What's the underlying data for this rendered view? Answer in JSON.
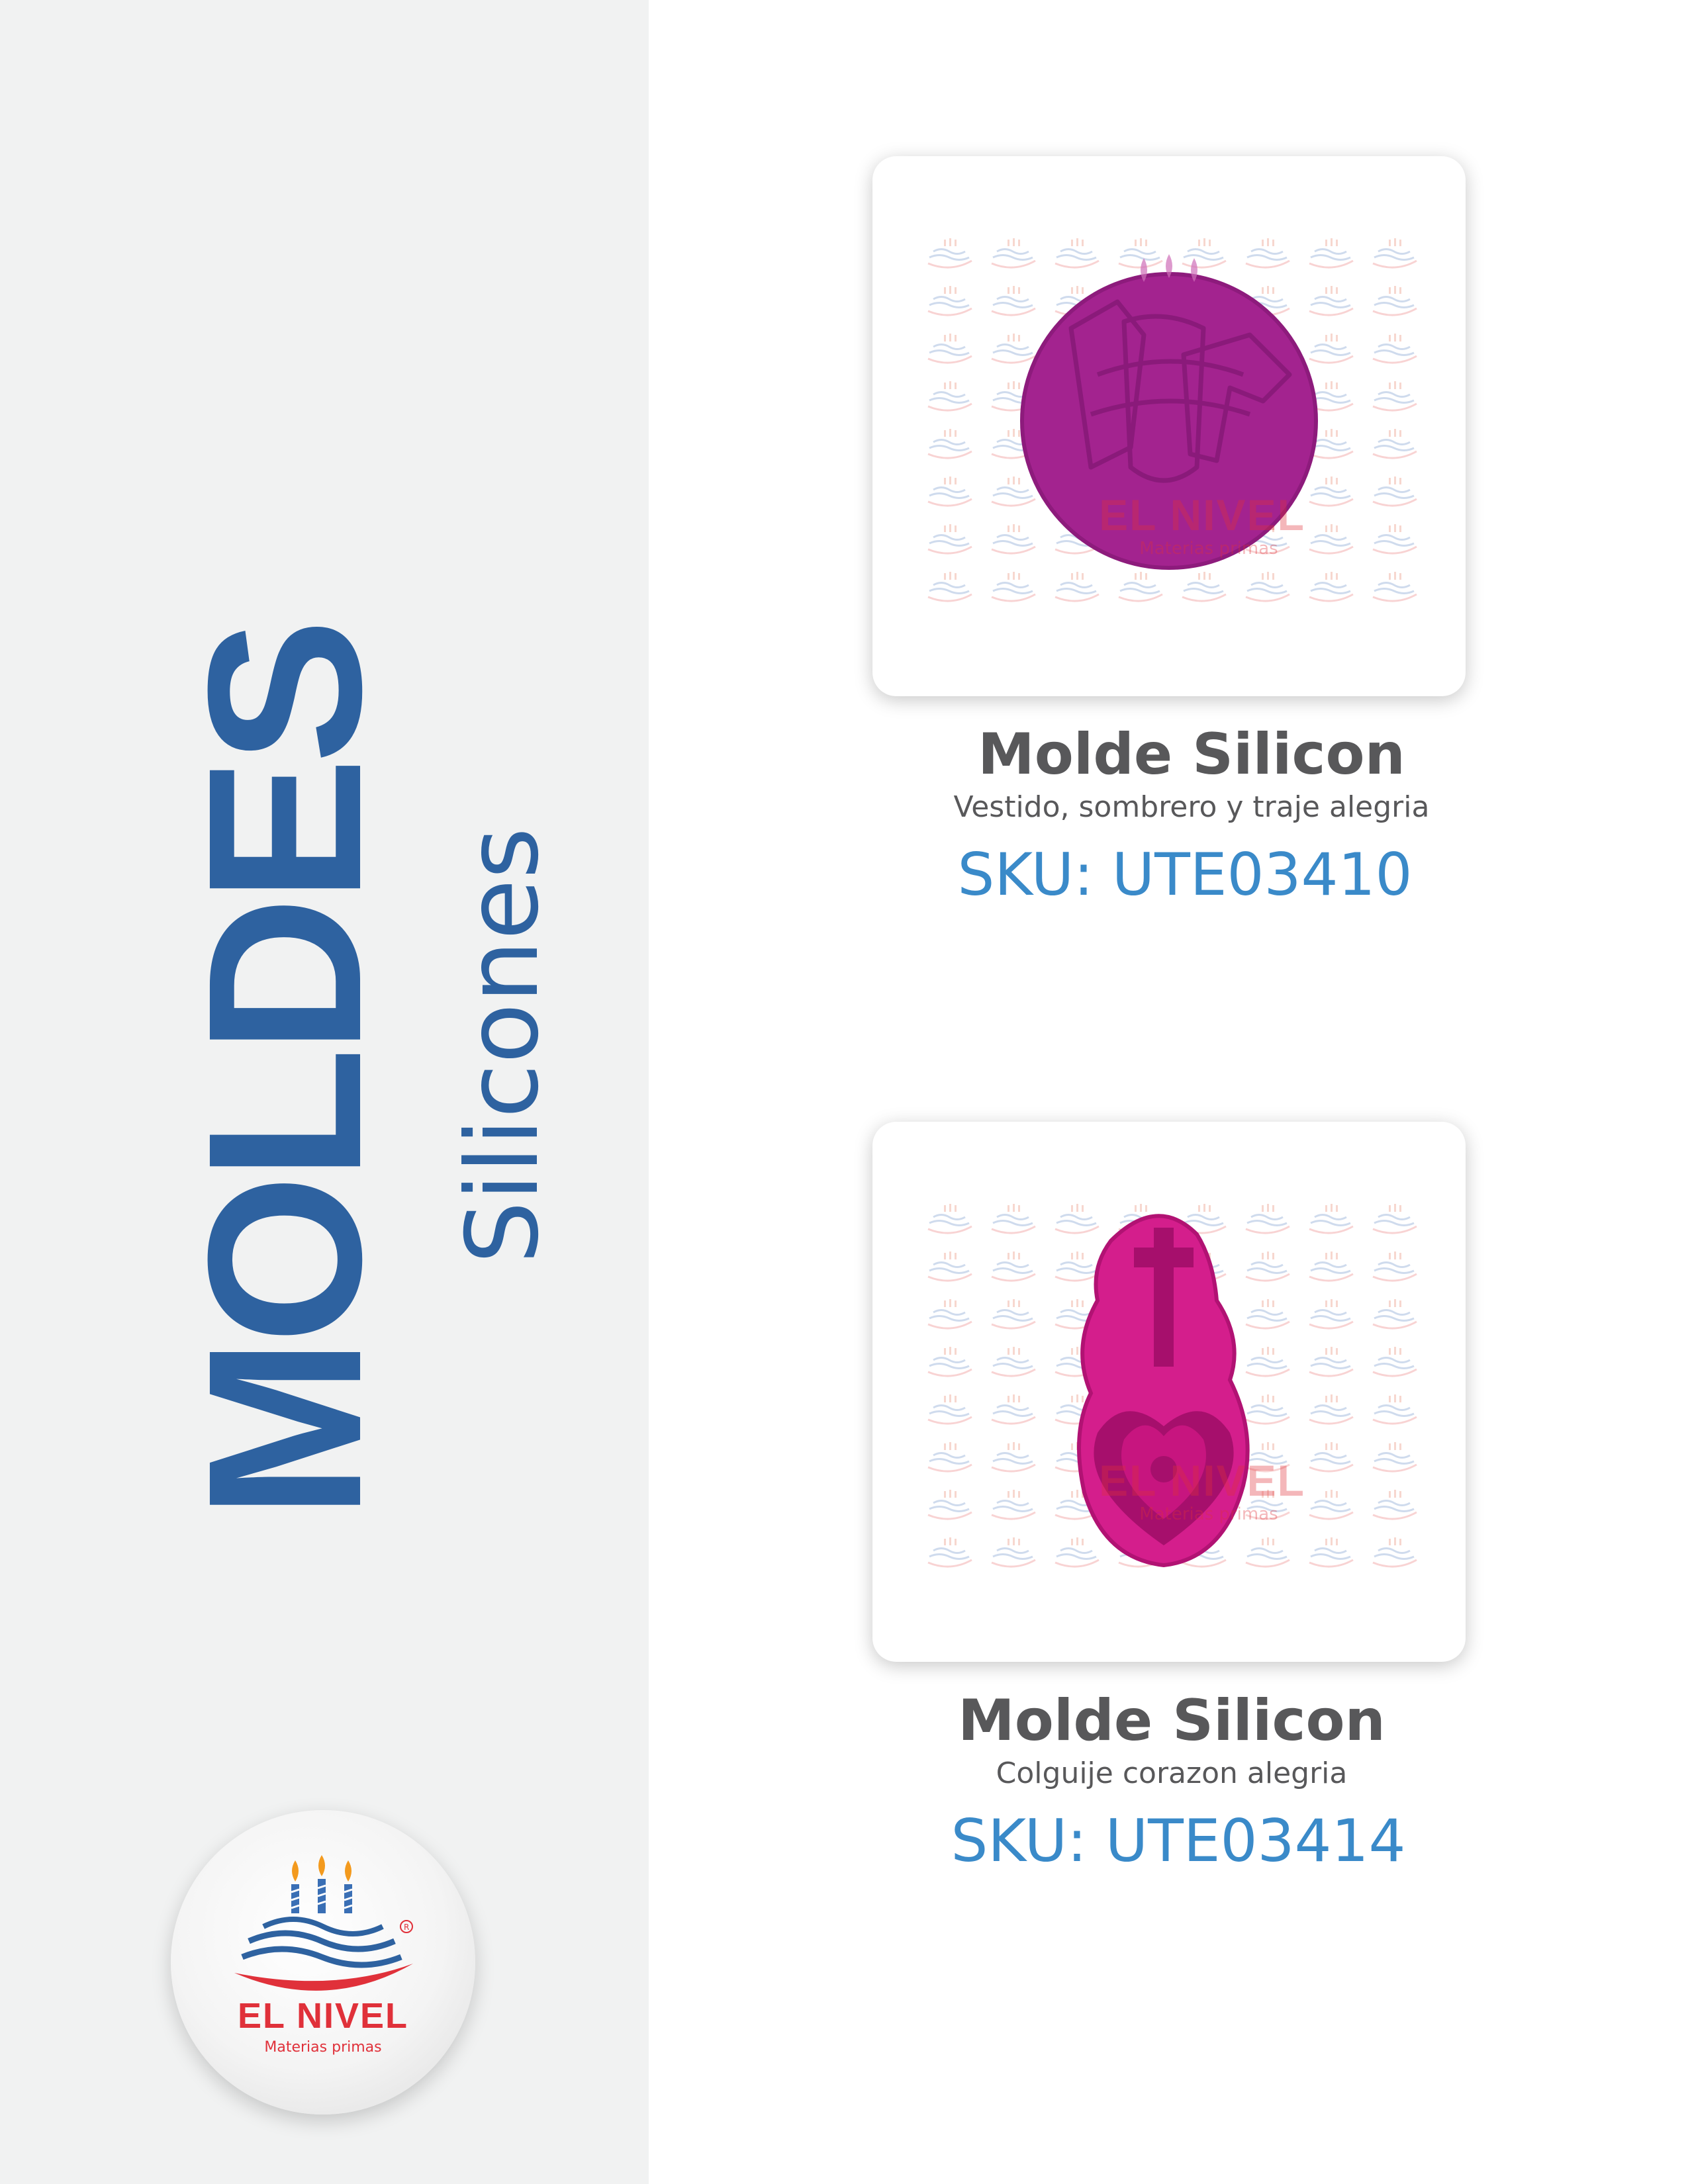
{
  "sidebar": {
    "title": "MOLDES",
    "subtitle": "Silicones",
    "logo": {
      "name": "EL NIVEL",
      "tagline": "Materias primas",
      "mark": "cake-candles-logo"
    }
  },
  "colors": {
    "brand_blue": "#2e62a0",
    "sku_blue": "#3a8ac9",
    "text_gray": "#58585a",
    "brand_red": "#e0313a",
    "mold_magenta": "#a3238f",
    "mold_pink": "#d41e8c"
  },
  "products": [
    {
      "name": "Molde Silicon",
      "description": "Vestido, sombrero y traje alegria",
      "sku": "SKU: UTE03410",
      "watermark_name": "EL NIVEL",
      "watermark_tag": "Materias primas"
    },
    {
      "name": "Molde Silicon",
      "description": "Colguije corazon alegria",
      "sku": "SKU: UTE03414",
      "watermark_name": "EL NIVEL",
      "watermark_tag": "Materias primas"
    }
  ]
}
